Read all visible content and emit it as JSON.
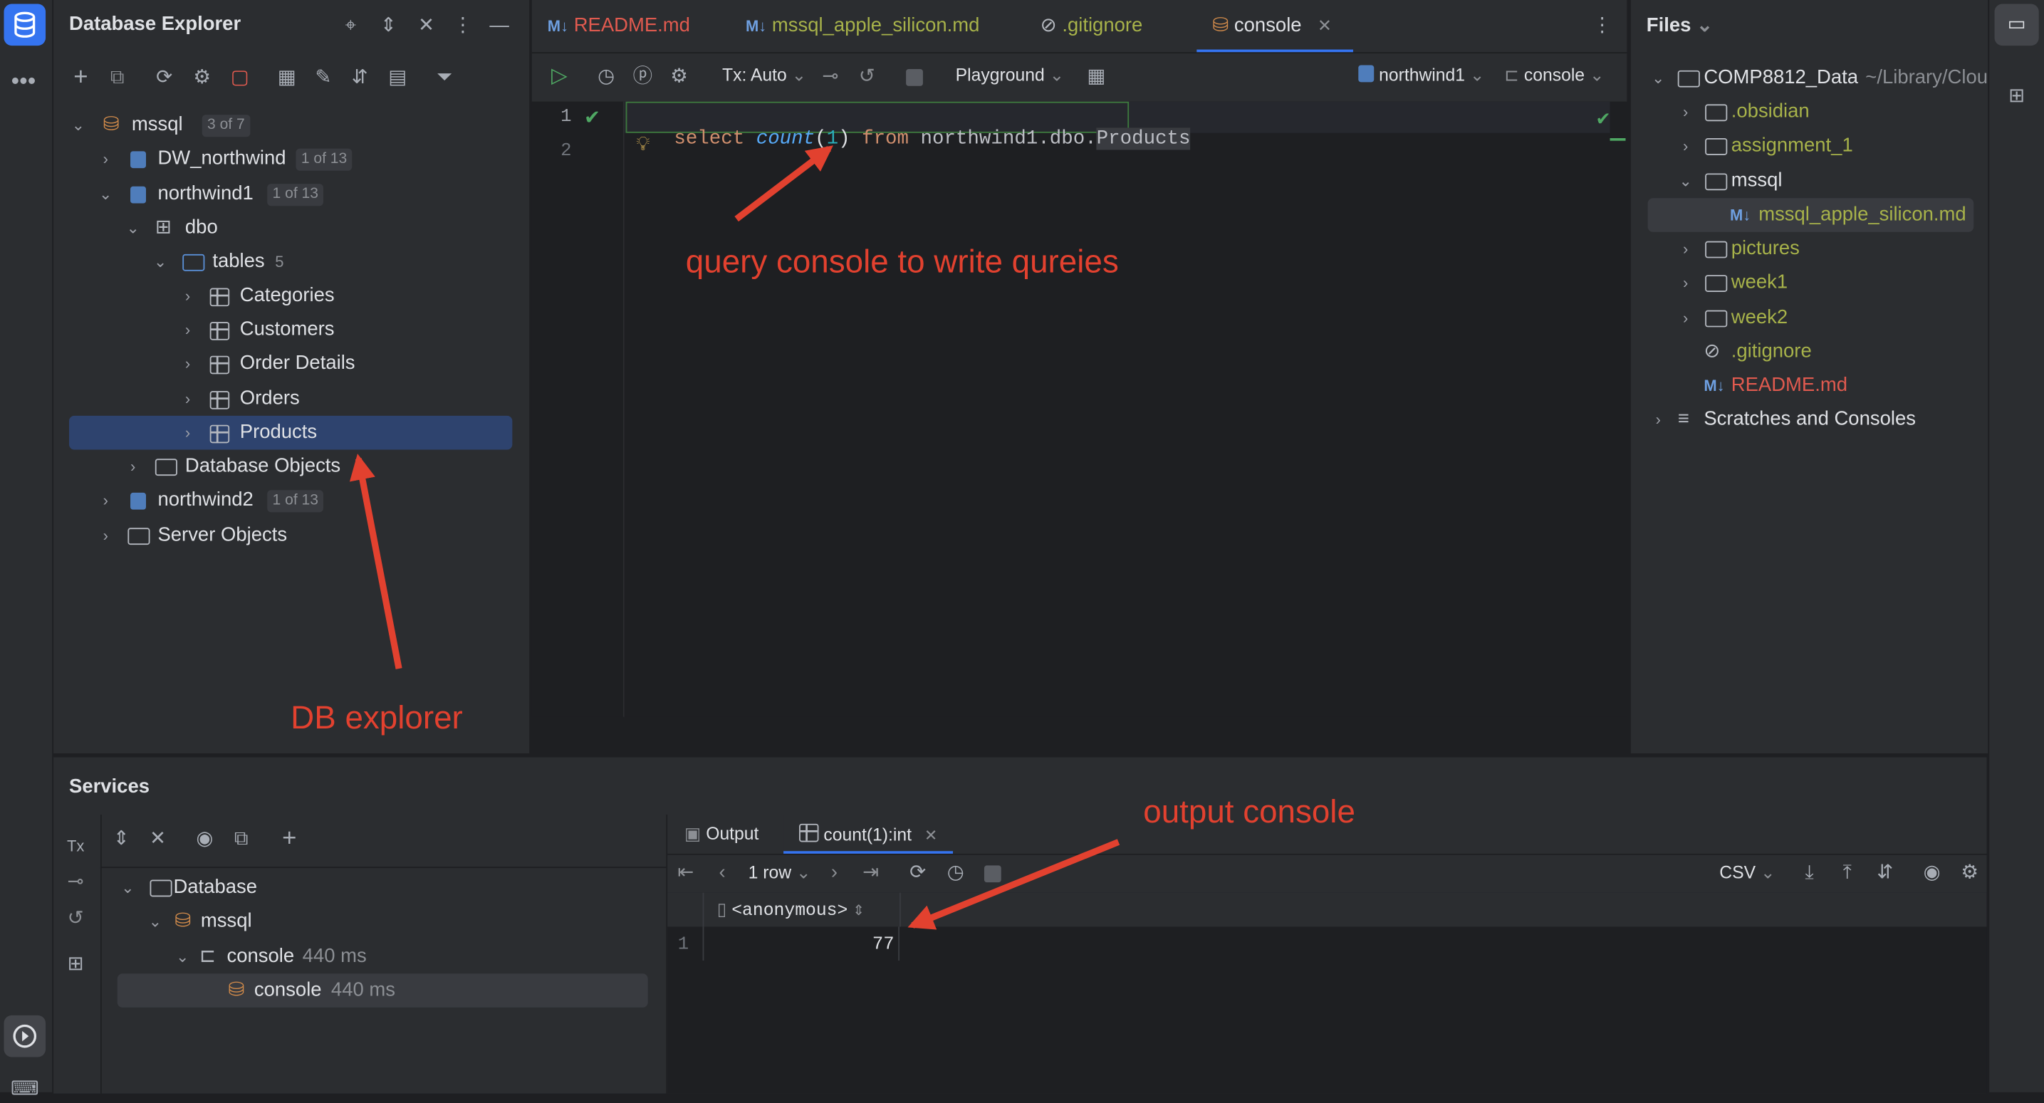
{
  "db_explorer": {
    "title": "Database Explorer",
    "tree": {
      "mssql": {
        "label": "mssql",
        "badge": "3 of 7"
      },
      "dw_northwind": {
        "label": "DW_northwind",
        "badge": "1 of 13"
      },
      "northwind1": {
        "label": "northwind1",
        "badge": "1 of 13"
      },
      "dbo": {
        "label": "dbo"
      },
      "tables": {
        "label": "tables",
        "count": "5"
      },
      "tables_list": [
        "Categories",
        "Customers",
        "Order Details",
        "Orders",
        "Products"
      ],
      "database_objects": {
        "label": "Database Objects"
      },
      "northwind2": {
        "label": "northwind2",
        "badge": "1 of 13"
      },
      "server_objects": {
        "label": "Server Objects"
      }
    }
  },
  "editor": {
    "tabs": [
      {
        "prefix": "M↓",
        "label": "README.md",
        "color": "#e05a4f"
      },
      {
        "prefix": "M↓",
        "label": "mssql_apple_silicon.md",
        "color": "#a7b24a"
      },
      {
        "prefix": "⊘",
        "label": ".gitignore",
        "color": "#a7b24a"
      },
      {
        "prefix": "",
        "label": "console",
        "color": "#dfe1e5"
      }
    ],
    "toolbar": {
      "tx_label": "Tx: Auto",
      "playground_label": "Playground",
      "schema_label": "northwind1",
      "session_label": "console"
    },
    "line_numbers": [
      "1",
      "2"
    ],
    "code": {
      "kw1": "select",
      "fn": "count",
      "arg": "1",
      "kw2": "from",
      "target": "northwind1.dbo.",
      "table": "Products"
    }
  },
  "files": {
    "title": "Files",
    "tree": {
      "root": {
        "label": "COMP8812_Data",
        "path": "~/Library/Clou"
      },
      "items": [
        ".obsidian",
        "assignment_1",
        "mssql",
        "mssql_apple_silicon.md",
        "pictures",
        "week1",
        "week2",
        ".gitignore",
        "README.md"
      ],
      "scratches": "Scratches and Consoles"
    }
  },
  "services": {
    "title": "Services",
    "tree": {
      "database": "Database",
      "mssql": "mssql",
      "console_parent": {
        "label": "console",
        "time": "440 ms"
      },
      "console_child": {
        "label": "console",
        "time": "440 ms"
      }
    },
    "output_tabs": [
      "Output",
      "count(1):int"
    ],
    "grid_toolbar": {
      "rows": "1 row",
      "format": "CSV"
    },
    "grid": {
      "column": "<anonymous>",
      "row_number": "1",
      "value": "77"
    }
  },
  "annotations": {
    "query_console": "query console to write qureies",
    "db_explorer": "DB explorer",
    "output_console": "output console"
  },
  "colors": {
    "accent": "#3574f0",
    "annotation": "#e2412f",
    "selection": "#2e436e",
    "git_modified": "#a7b24a"
  }
}
